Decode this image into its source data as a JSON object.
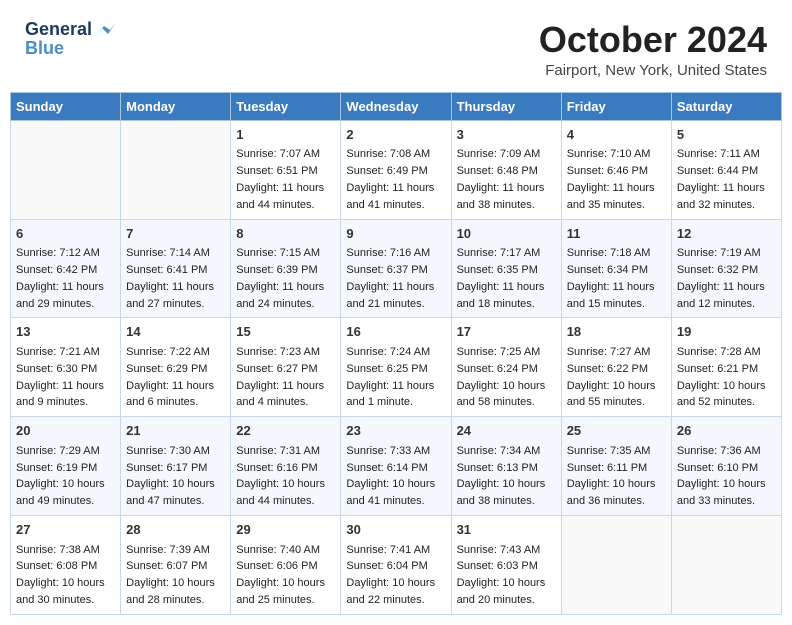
{
  "header": {
    "logo_line1": "General",
    "logo_line2": "Blue",
    "month": "October 2024",
    "location": "Fairport, New York, United States"
  },
  "days_of_week": [
    "Sunday",
    "Monday",
    "Tuesday",
    "Wednesday",
    "Thursday",
    "Friday",
    "Saturday"
  ],
  "weeks": [
    [
      {
        "day": "",
        "sunrise": "",
        "sunset": "",
        "daylight": ""
      },
      {
        "day": "",
        "sunrise": "",
        "sunset": "",
        "daylight": ""
      },
      {
        "day": "1",
        "sunrise": "Sunrise: 7:07 AM",
        "sunset": "Sunset: 6:51 PM",
        "daylight": "Daylight: 11 hours and 44 minutes."
      },
      {
        "day": "2",
        "sunrise": "Sunrise: 7:08 AM",
        "sunset": "Sunset: 6:49 PM",
        "daylight": "Daylight: 11 hours and 41 minutes."
      },
      {
        "day": "3",
        "sunrise": "Sunrise: 7:09 AM",
        "sunset": "Sunset: 6:48 PM",
        "daylight": "Daylight: 11 hours and 38 minutes."
      },
      {
        "day": "4",
        "sunrise": "Sunrise: 7:10 AM",
        "sunset": "Sunset: 6:46 PM",
        "daylight": "Daylight: 11 hours and 35 minutes."
      },
      {
        "day": "5",
        "sunrise": "Sunrise: 7:11 AM",
        "sunset": "Sunset: 6:44 PM",
        "daylight": "Daylight: 11 hours and 32 minutes."
      }
    ],
    [
      {
        "day": "6",
        "sunrise": "Sunrise: 7:12 AM",
        "sunset": "Sunset: 6:42 PM",
        "daylight": "Daylight: 11 hours and 29 minutes."
      },
      {
        "day": "7",
        "sunrise": "Sunrise: 7:14 AM",
        "sunset": "Sunset: 6:41 PM",
        "daylight": "Daylight: 11 hours and 27 minutes."
      },
      {
        "day": "8",
        "sunrise": "Sunrise: 7:15 AM",
        "sunset": "Sunset: 6:39 PM",
        "daylight": "Daylight: 11 hours and 24 minutes."
      },
      {
        "day": "9",
        "sunrise": "Sunrise: 7:16 AM",
        "sunset": "Sunset: 6:37 PM",
        "daylight": "Daylight: 11 hours and 21 minutes."
      },
      {
        "day": "10",
        "sunrise": "Sunrise: 7:17 AM",
        "sunset": "Sunset: 6:35 PM",
        "daylight": "Daylight: 11 hours and 18 minutes."
      },
      {
        "day": "11",
        "sunrise": "Sunrise: 7:18 AM",
        "sunset": "Sunset: 6:34 PM",
        "daylight": "Daylight: 11 hours and 15 minutes."
      },
      {
        "day": "12",
        "sunrise": "Sunrise: 7:19 AM",
        "sunset": "Sunset: 6:32 PM",
        "daylight": "Daylight: 11 hours and 12 minutes."
      }
    ],
    [
      {
        "day": "13",
        "sunrise": "Sunrise: 7:21 AM",
        "sunset": "Sunset: 6:30 PM",
        "daylight": "Daylight: 11 hours and 9 minutes."
      },
      {
        "day": "14",
        "sunrise": "Sunrise: 7:22 AM",
        "sunset": "Sunset: 6:29 PM",
        "daylight": "Daylight: 11 hours and 6 minutes."
      },
      {
        "day": "15",
        "sunrise": "Sunrise: 7:23 AM",
        "sunset": "Sunset: 6:27 PM",
        "daylight": "Daylight: 11 hours and 4 minutes."
      },
      {
        "day": "16",
        "sunrise": "Sunrise: 7:24 AM",
        "sunset": "Sunset: 6:25 PM",
        "daylight": "Daylight: 11 hours and 1 minute."
      },
      {
        "day": "17",
        "sunrise": "Sunrise: 7:25 AM",
        "sunset": "Sunset: 6:24 PM",
        "daylight": "Daylight: 10 hours and 58 minutes."
      },
      {
        "day": "18",
        "sunrise": "Sunrise: 7:27 AM",
        "sunset": "Sunset: 6:22 PM",
        "daylight": "Daylight: 10 hours and 55 minutes."
      },
      {
        "day": "19",
        "sunrise": "Sunrise: 7:28 AM",
        "sunset": "Sunset: 6:21 PM",
        "daylight": "Daylight: 10 hours and 52 minutes."
      }
    ],
    [
      {
        "day": "20",
        "sunrise": "Sunrise: 7:29 AM",
        "sunset": "Sunset: 6:19 PM",
        "daylight": "Daylight: 10 hours and 49 minutes."
      },
      {
        "day": "21",
        "sunrise": "Sunrise: 7:30 AM",
        "sunset": "Sunset: 6:17 PM",
        "daylight": "Daylight: 10 hours and 47 minutes."
      },
      {
        "day": "22",
        "sunrise": "Sunrise: 7:31 AM",
        "sunset": "Sunset: 6:16 PM",
        "daylight": "Daylight: 10 hours and 44 minutes."
      },
      {
        "day": "23",
        "sunrise": "Sunrise: 7:33 AM",
        "sunset": "Sunset: 6:14 PM",
        "daylight": "Daylight: 10 hours and 41 minutes."
      },
      {
        "day": "24",
        "sunrise": "Sunrise: 7:34 AM",
        "sunset": "Sunset: 6:13 PM",
        "daylight": "Daylight: 10 hours and 38 minutes."
      },
      {
        "day": "25",
        "sunrise": "Sunrise: 7:35 AM",
        "sunset": "Sunset: 6:11 PM",
        "daylight": "Daylight: 10 hours and 36 minutes."
      },
      {
        "day": "26",
        "sunrise": "Sunrise: 7:36 AM",
        "sunset": "Sunset: 6:10 PM",
        "daylight": "Daylight: 10 hours and 33 minutes."
      }
    ],
    [
      {
        "day": "27",
        "sunrise": "Sunrise: 7:38 AM",
        "sunset": "Sunset: 6:08 PM",
        "daylight": "Daylight: 10 hours and 30 minutes."
      },
      {
        "day": "28",
        "sunrise": "Sunrise: 7:39 AM",
        "sunset": "Sunset: 6:07 PM",
        "daylight": "Daylight: 10 hours and 28 minutes."
      },
      {
        "day": "29",
        "sunrise": "Sunrise: 7:40 AM",
        "sunset": "Sunset: 6:06 PM",
        "daylight": "Daylight: 10 hours and 25 minutes."
      },
      {
        "day": "30",
        "sunrise": "Sunrise: 7:41 AM",
        "sunset": "Sunset: 6:04 PM",
        "daylight": "Daylight: 10 hours and 22 minutes."
      },
      {
        "day": "31",
        "sunrise": "Sunrise: 7:43 AM",
        "sunset": "Sunset: 6:03 PM",
        "daylight": "Daylight: 10 hours and 20 minutes."
      },
      {
        "day": "",
        "sunrise": "",
        "sunset": "",
        "daylight": ""
      },
      {
        "day": "",
        "sunrise": "",
        "sunset": "",
        "daylight": ""
      }
    ]
  ]
}
